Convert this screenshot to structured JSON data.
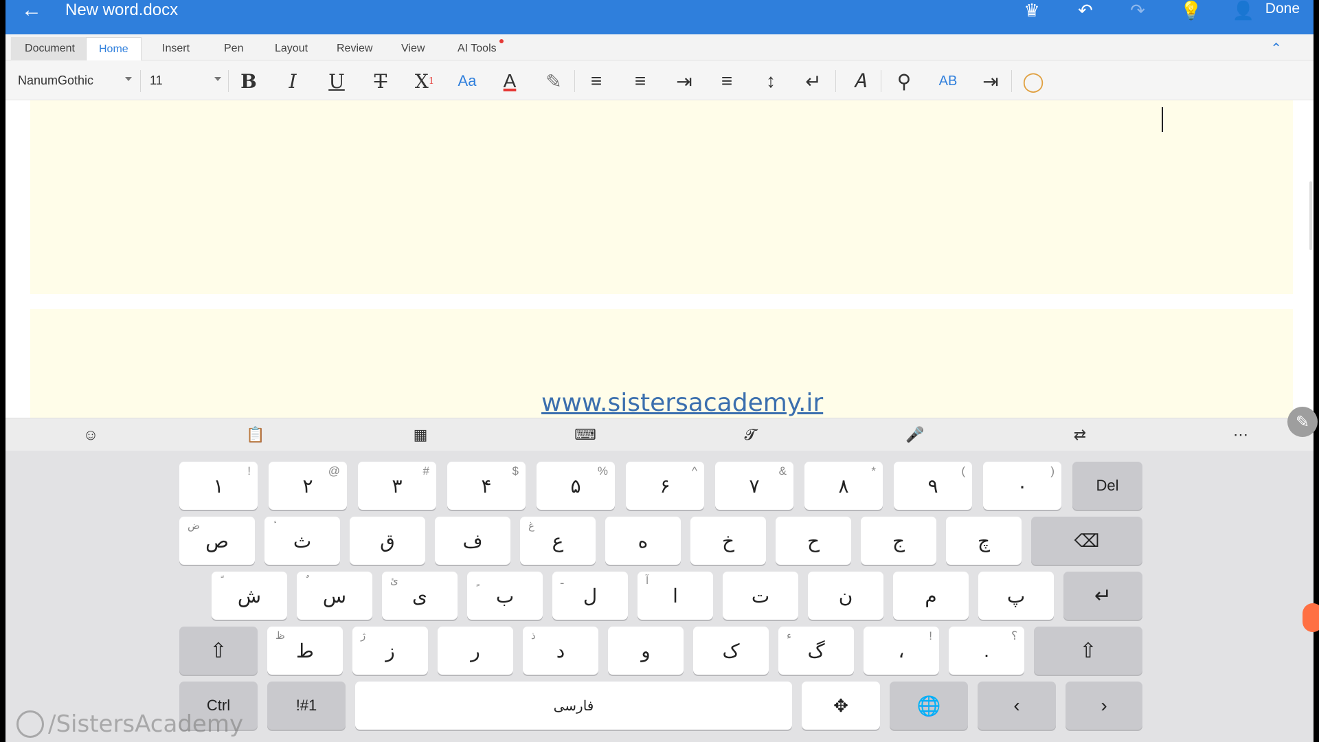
{
  "titlebar": {
    "back_icon": "arrow-left-icon",
    "title": "New word.docx",
    "done_label": "Done"
  },
  "menu": {
    "tabs": [
      "Document",
      "Home",
      "Insert",
      "Pen",
      "Layout",
      "Review",
      "View",
      "AI Tools"
    ],
    "active": "Home"
  },
  "toolbar": {
    "font": "NanumGothic",
    "size": "11"
  },
  "watermark": {
    "url": "www.sistersacademy.ir",
    "handle": "/SistersAcademy"
  },
  "keyboard": {
    "row1": [
      {
        "main": "١",
        "alt": "!"
      },
      {
        "main": "٢",
        "alt": "@"
      },
      {
        "main": "٣",
        "alt": "#"
      },
      {
        "main": "۴",
        "alt": "$"
      },
      {
        "main": "۵",
        "alt": "%"
      },
      {
        "main": "۶",
        "alt": "^"
      },
      {
        "main": "٧",
        "alt": "&"
      },
      {
        "main": "٨",
        "alt": "*"
      },
      {
        "main": "٩",
        "alt": "("
      },
      {
        "main": "٠",
        "alt": ")"
      }
    ],
    "del_label": "Del",
    "row2": [
      {
        "main": "ص",
        "alt": "ض"
      },
      {
        "main": "ث",
        "alt": "ٔ"
      },
      {
        "main": "ق",
        "alt": ""
      },
      {
        "main": "ف",
        "alt": ""
      },
      {
        "main": "ع",
        "alt": "غ"
      },
      {
        "main": "ه",
        "alt": ""
      },
      {
        "main": "خ",
        "alt": ""
      },
      {
        "main": "ح",
        "alt": ""
      },
      {
        "main": "ج",
        "alt": ""
      },
      {
        "main": "چ",
        "alt": ""
      }
    ],
    "row3": [
      {
        "main": "ش",
        "alt": "ً"
      },
      {
        "main": "س",
        "alt": "ٌ"
      },
      {
        "main": "ی",
        "alt": "ئ"
      },
      {
        "main": "ب",
        "alt": "ٍ"
      },
      {
        "main": "ل",
        "alt": "ـ"
      },
      {
        "main": "ا",
        "alt": "آ"
      },
      {
        "main": "ت",
        "alt": ""
      },
      {
        "main": "ن",
        "alt": ""
      },
      {
        "main": "م",
        "alt": ""
      },
      {
        "main": "پ",
        "alt": ""
      }
    ],
    "row4": [
      {
        "main": "ط",
        "alt": "ظ"
      },
      {
        "main": "ز",
        "alt": "ژ"
      },
      {
        "main": "ر",
        "alt": ""
      },
      {
        "main": "د",
        "alt": "ذ"
      },
      {
        "main": "و",
        "alt": ""
      },
      {
        "main": "ک",
        "alt": ""
      },
      {
        "main": "گ",
        "alt": "ء"
      },
      {
        "main": "،",
        "alt": "!"
      },
      {
        "main": ".",
        "alt": "؟"
      }
    ],
    "ctrl_label": "Ctrl",
    "symbols_label": "!#1",
    "space_label": "فارسی"
  }
}
